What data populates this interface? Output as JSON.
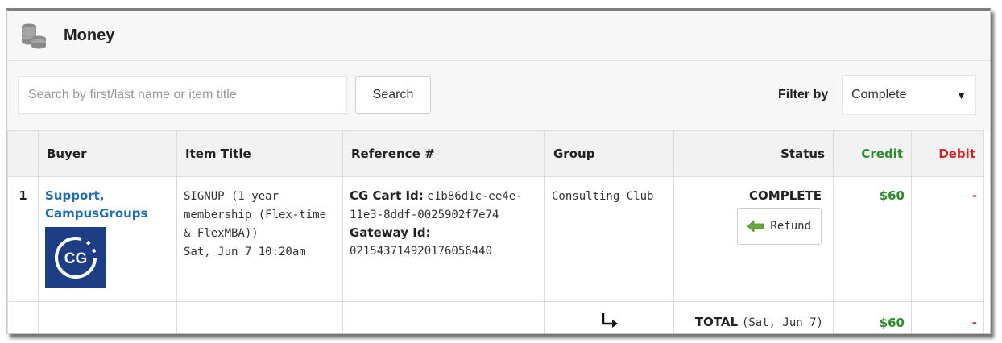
{
  "header": {
    "title": "Money",
    "icon": "coins-icon"
  },
  "toolbar": {
    "search_placeholder": "Search by first/last name or item title",
    "search_value": "",
    "search_label": "Search",
    "filter_label": "Filter by",
    "filter_selected": "Complete",
    "filter_caret": "▼"
  },
  "table": {
    "columns": [
      "",
      "Buyer",
      "Item Title",
      "Reference #",
      "Group",
      "Status",
      "Credit",
      "Debit"
    ],
    "rows": [
      {
        "num": "1",
        "buyer_line1": "Support,",
        "buyer_line2": "CampusGroups",
        "avatar_text": "CG",
        "item_title": "SIGNUP (1 year membership (Flex-time & FlexMBA))",
        "item_date": "Sat, Jun 7 10:20am",
        "cart_id_label": "CG Cart Id:",
        "cart_id_value": "e1b86d1c-ee4e-11e3-8ddf-0025902f7e74",
        "gateway_label": "Gateway Id:",
        "gateway_value": "021543714920176056440",
        "group": "Consulting Club",
        "status": "COMPLETE",
        "refund_label": "Refund",
        "credit": "$60",
        "debit": "-"
      }
    ],
    "total": {
      "arrow": "↳",
      "label": "TOTAL",
      "date": "(Sat, Jun 7)",
      "credit": "$60",
      "debit": "-"
    }
  },
  "colors": {
    "link": "#1f6db0",
    "credit": "#2e8b2e",
    "debit": "#d92020",
    "refund_arrow": "#6aa83a",
    "avatar_bg": "#1d3d85"
  }
}
